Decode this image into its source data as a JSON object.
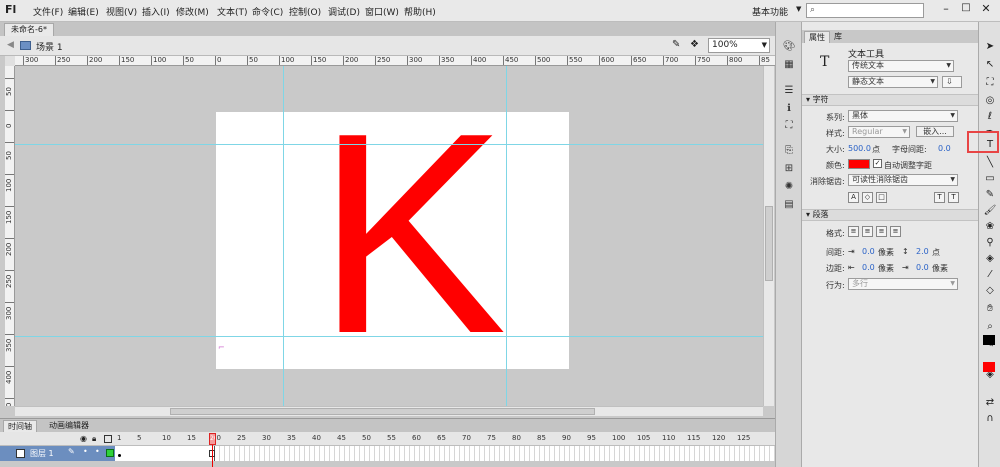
{
  "app": {
    "logo": "Fl",
    "menu": [
      "文件(F)",
      "编辑(E)",
      "视图(V)",
      "插入(I)",
      "修改(M)",
      "文本(T)",
      "命令(C)",
      "控制(O)",
      "调试(D)",
      "窗口(W)",
      "帮助(H)"
    ],
    "workspace": "基本功能",
    "search_icon": "magnifier-icon"
  },
  "document": {
    "tab": "未命名-6*",
    "scene": "场景 1",
    "zoom": "100%",
    "stage_letter": "K",
    "stage_color": "#ff0000",
    "ruler_h_labels": [
      "300",
      "250",
      "200",
      "150",
      "100",
      "50",
      "0",
      "50",
      "100",
      "150",
      "200",
      "250",
      "300",
      "350",
      "400",
      "450",
      "500",
      "550",
      "600",
      "650",
      "700",
      "750",
      "800",
      "85"
    ],
    "ruler_v_labels": [
      "50",
      "0",
      "50",
      "100",
      "150",
      "200",
      "250",
      "300",
      "350",
      "400",
      "450"
    ]
  },
  "timeline": {
    "tabs": [
      "时间轴",
      "动画编辑器"
    ],
    "frame_numbers": [
      "1",
      "5",
      "10",
      "15",
      "20",
      "25",
      "30",
      "35",
      "40",
      "45",
      "50",
      "55",
      "60",
      "65",
      "70",
      "75",
      "80",
      "85",
      "90",
      "95",
      "100",
      "105",
      "110",
      "115",
      "120",
      "125"
    ],
    "current_frame": "20",
    "layer": {
      "name": "图层 1",
      "color": "#2fd13a"
    }
  },
  "properties": {
    "tabs": [
      "属性",
      "库"
    ],
    "tool_name": "文本工具",
    "text_engine": "传统文本",
    "text_type": "静态文本",
    "sections": {
      "character": "字符",
      "paragraph": "段落"
    },
    "family_label": "系列:",
    "family_value": "黑体",
    "style_label": "样式:",
    "style_value": "Regular",
    "embed_label": "嵌入...",
    "size_label": "大小:",
    "size_value": "500.0",
    "size_unit": "点",
    "spacing_label": "字母间距:",
    "spacing_value": "0.0",
    "color_label": "颜色:",
    "auto_kern_label": "自动调整字距",
    "aa_label": "消除锯齿:",
    "aa_value": "可读性消除锯齿",
    "format_label": "格式:",
    "gap_label": "间距:",
    "gap_value": "0.0",
    "gap_unit": "像素",
    "line_value": "2.0",
    "line_unit": "点",
    "margin_label": "边距:",
    "margin_left_value": "0.0",
    "margin_left_unit": "像素",
    "margin_right_value": "0.0",
    "margin_right_unit": "像素",
    "behavior_label": "行为:",
    "behavior_value": "多行"
  },
  "colors": {
    "stroke": "#000000",
    "fill": "#ff0000",
    "highlight": "#e84545"
  }
}
